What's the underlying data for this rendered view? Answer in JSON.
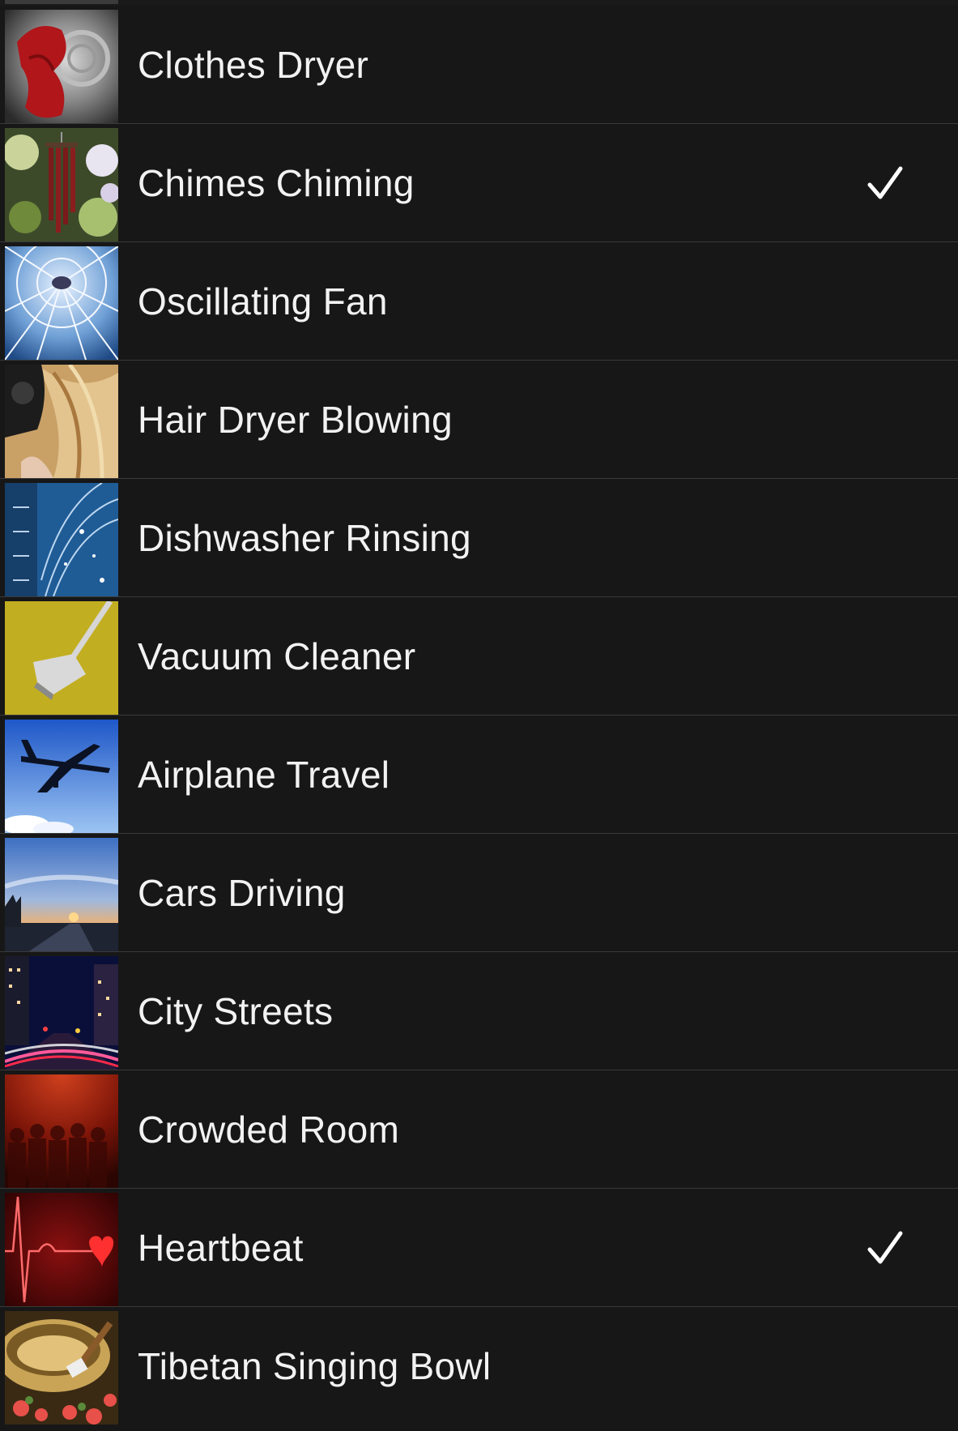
{
  "sounds": [
    {
      "label": "Clothes Dryer",
      "icon": "clothes-dryer-thumbnail",
      "selected": false
    },
    {
      "label": "Chimes Chiming",
      "icon": "wind-chimes-thumbnail",
      "selected": true
    },
    {
      "label": "Oscillating Fan",
      "icon": "fan-thumbnail",
      "selected": false
    },
    {
      "label": "Hair Dryer Blowing",
      "icon": "hair-dryer-thumbnail",
      "selected": false
    },
    {
      "label": "Dishwasher Rinsing",
      "icon": "water-spray-thumbnail",
      "selected": false
    },
    {
      "label": "Vacuum Cleaner",
      "icon": "vacuum-thumbnail",
      "selected": false
    },
    {
      "label": "Airplane Travel",
      "icon": "airplane-thumbnail",
      "selected": false
    },
    {
      "label": "Cars Driving",
      "icon": "road-sunset-thumbnail",
      "selected": false
    },
    {
      "label": "City Streets",
      "icon": "city-night-thumbnail",
      "selected": false
    },
    {
      "label": "Crowded Room",
      "icon": "crowd-thumbnail",
      "selected": false
    },
    {
      "label": "Heartbeat",
      "icon": "heartbeat-thumbnail",
      "selected": true
    },
    {
      "label": "Tibetan Singing Bowl",
      "icon": "singing-bowl-thumbnail",
      "selected": false
    }
  ],
  "colors": {
    "background": "#171717",
    "separator": "#3a3a3a",
    "text": "#f2f2f2",
    "checkmark": "#ffffff"
  }
}
